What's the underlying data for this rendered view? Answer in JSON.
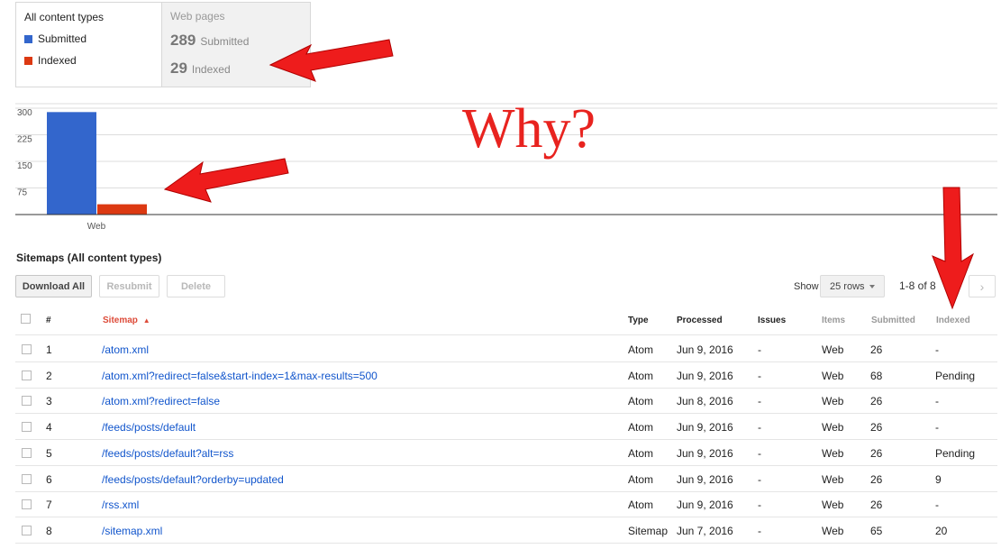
{
  "legend": {
    "title": "All content types",
    "submitted_label": "Submitted",
    "indexed_label": "Indexed",
    "submitted_color": "#3366cc",
    "indexed_color": "#dc3912"
  },
  "web_pages": {
    "title": "Web pages",
    "submitted_count": "289",
    "submitted_label": "Submitted",
    "indexed_count": "29",
    "indexed_label": "Indexed"
  },
  "annotation": {
    "text": "Why?",
    "arrow_color": "#e8231f"
  },
  "chart_data": {
    "type": "bar",
    "categories": [
      "Web"
    ],
    "series": [
      {
        "name": "Submitted",
        "values": [
          289
        ]
      },
      {
        "name": "Indexed",
        "values": [
          29
        ]
      }
    ],
    "y_ticks": [
      75,
      150,
      225,
      300
    ],
    "ylim": [
      0,
      300
    ],
    "grid": true
  },
  "section": {
    "title": "Sitemaps (All content types)",
    "download_all": "Download All",
    "resubmit": "Resubmit",
    "delete": "Delete",
    "show_label": "Show",
    "rows_select": "25 rows",
    "pager_text": "1-8 of 8"
  },
  "table": {
    "headers": {
      "num": "#",
      "sitemap": "Sitemap",
      "type": "Type",
      "processed": "Processed",
      "issues": "Issues",
      "items": "Items",
      "submitted": "Submitted",
      "indexed": "Indexed"
    },
    "rows": [
      {
        "num": "1",
        "sitemap": "/atom.xml",
        "type": "Atom",
        "processed": "Jun 9, 2016",
        "issues": "-",
        "items": "Web",
        "submitted": "26",
        "indexed": "-"
      },
      {
        "num": "2",
        "sitemap": "/atom.xml?redirect=false&start-index=1&max-results=500",
        "type": "Atom",
        "processed": "Jun 9, 2016",
        "issues": "-",
        "items": "Web",
        "submitted": "68",
        "indexed": "Pending"
      },
      {
        "num": "3",
        "sitemap": "/atom.xml?redirect=false",
        "type": "Atom",
        "processed": "Jun 8, 2016",
        "issues": "-",
        "items": "Web",
        "submitted": "26",
        "indexed": "-"
      },
      {
        "num": "4",
        "sitemap": "/feeds/posts/default",
        "type": "Atom",
        "processed": "Jun 9, 2016",
        "issues": "-",
        "items": "Web",
        "submitted": "26",
        "indexed": "-"
      },
      {
        "num": "5",
        "sitemap": "/feeds/posts/default?alt=rss",
        "type": "Atom",
        "processed": "Jun 9, 2016",
        "issues": "-",
        "items": "Web",
        "submitted": "26",
        "indexed": "Pending"
      },
      {
        "num": "6",
        "sitemap": "/feeds/posts/default?orderby=updated",
        "type": "Atom",
        "processed": "Jun 9, 2016",
        "issues": "-",
        "items": "Web",
        "submitted": "26",
        "indexed": "9"
      },
      {
        "num": "7",
        "sitemap": "/rss.xml",
        "type": "Atom",
        "processed": "Jun 9, 2016",
        "issues": "-",
        "items": "Web",
        "submitted": "26",
        "indexed": "-"
      },
      {
        "num": "8",
        "sitemap": "/sitemap.xml",
        "type": "Sitemap",
        "processed": "Jun 7, 2016",
        "issues": "-",
        "items": "Web",
        "submitted": "65",
        "indexed": "20"
      }
    ]
  }
}
